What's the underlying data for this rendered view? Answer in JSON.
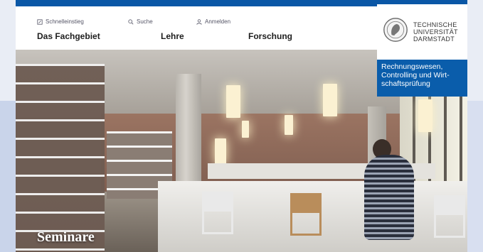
{
  "utility_nav": [
    {
      "label": "Schnelleinstieg",
      "icon": "edit-icon"
    },
    {
      "label": "Suche",
      "icon": "search-icon"
    },
    {
      "label": "Anmelden",
      "icon": "user-icon"
    }
  ],
  "main_nav": [
    {
      "label": "Das Fachgebiet"
    },
    {
      "label": "Lehre"
    },
    {
      "label": "Forschung"
    }
  ],
  "logo": {
    "lines": [
      "TECHNISCHE",
      "UNIVERSITÄT",
      "DARMSTADT"
    ]
  },
  "institute": {
    "lines": [
      "Rechnungswesen,",
      "Controlling und Wirt-",
      "schaftsprüfung"
    ]
  },
  "hero": {
    "title": "Seminare"
  },
  "colors": {
    "brand_blue": "#0a5dab",
    "top_strip": "#0a57a6",
    "side_panel": "#c9d4ea"
  }
}
